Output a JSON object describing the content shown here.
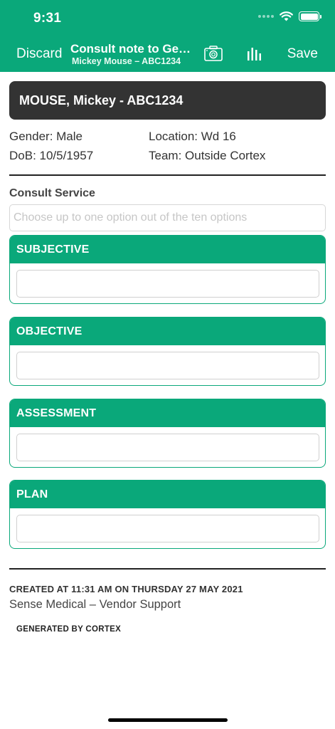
{
  "status_bar": {
    "time": "9:31"
  },
  "nav": {
    "discard_label": "Discard",
    "title": "Consult note to Gen...",
    "subtitle": "Mickey Mouse – ABC1234",
    "save_label": "Save",
    "icons": [
      "camera-icon",
      "chart-icon"
    ]
  },
  "patient": {
    "banner": "MOUSE, Mickey - ABC1234",
    "gender": "Gender: Male",
    "location": "Location: Wd 16",
    "dob": "DoB: 10/5/1957",
    "team": "Team: Outside Cortex"
  },
  "consult_service": {
    "label": "Consult Service",
    "placeholder": "Choose up to one option out of the ten options"
  },
  "sections": [
    {
      "title": "SUBJECTIVE",
      "value": ""
    },
    {
      "title": "OBJECTIVE",
      "value": ""
    },
    {
      "title": "ASSESSMENT",
      "value": ""
    },
    {
      "title": "PLAN",
      "value": ""
    }
  ],
  "footer": {
    "created": "CREATED AT 11:31 AM ON THURSDAY 27 MAY 2021",
    "vendor": "Sense Medical – Vendor Support",
    "generated": "GENERATED BY CORTEX"
  },
  "colors": {
    "brand": "#0aa87a",
    "banner": "#333333"
  }
}
